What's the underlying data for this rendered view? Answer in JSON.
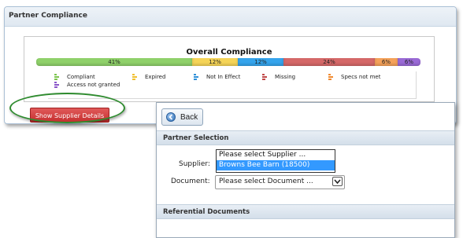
{
  "panel": {
    "title": "Partner Compliance"
  },
  "chart": {
    "title": "Overall Compliance",
    "segments": [
      {
        "label": "41%",
        "share": 41,
        "color": "#8fd16a"
      },
      {
        "label": "12%",
        "share": 12,
        "color": "#f5d457"
      },
      {
        "label": "12%",
        "share": 12,
        "color": "#35a4ec"
      },
      {
        "label": "24%",
        "share": 24,
        "color": "#d56868"
      },
      {
        "label": "6%",
        "share": 6,
        "color": "#f5a25a"
      },
      {
        "label": "6%",
        "share": 6,
        "color": "#9a6ad6"
      }
    ],
    "legend": [
      {
        "label": "Compliant",
        "color": "#7cc44e"
      },
      {
        "label": "Expired",
        "color": "#f0c030"
      },
      {
        "label": "Not In Effect",
        "color": "#2f90d8"
      },
      {
        "label": "Missing",
        "color": "#c04848"
      },
      {
        "label": "Specs not met",
        "color": "#f08a30"
      },
      {
        "label": "Access not granted",
        "color": "#8a56c8"
      }
    ]
  },
  "chart_data": {
    "type": "bar",
    "title": "Overall Compliance",
    "categories": [
      "Compliant",
      "Expired",
      "Not In Effect",
      "Missing",
      "Specs not met",
      "Access not granted"
    ],
    "values": [
      41,
      12,
      12,
      24,
      6,
      6
    ],
    "stacked": true,
    "unit": "%"
  },
  "actions": {
    "show_details_label": "Show Supplier Details"
  },
  "popup": {
    "back_label": "Back",
    "partner_section_title": "Partner Selection",
    "supplier_label": "Supplier:",
    "supplier_options": [
      "Please select Supplier ...",
      "Browns Bee Barn (18500)"
    ],
    "selected_supplier_index": 1,
    "document_label": "Document:",
    "document_value": "Please select Document ...",
    "referential_section_title": "Referential Documents"
  }
}
